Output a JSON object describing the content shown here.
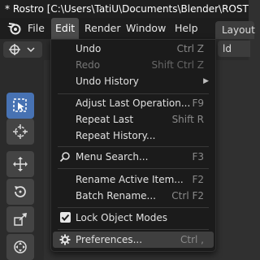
{
  "window": {
    "title": "* Rostro [C:\\Users\\TatiU\\Documents\\Blender\\ROSTRO"
  },
  "menubar": {
    "items": [
      "File",
      "Edit",
      "Render",
      "Window",
      "Help"
    ],
    "active": "Edit",
    "workspace_tab": "Layout"
  },
  "header": {
    "right_dropdown": "ld"
  },
  "toolbar": {
    "tools": [
      "select-box",
      "cursor",
      "move",
      "rotate",
      "scale",
      "transform"
    ],
    "active": "select-box"
  },
  "edit_menu": {
    "items": [
      {
        "label": "Undo",
        "shortcut": "Ctrl Z",
        "enabled": true
      },
      {
        "label": "Redo",
        "shortcut": "Shift Ctrl Z",
        "enabled": false
      },
      {
        "label": "Undo History",
        "shortcut": "",
        "enabled": true,
        "submenu": true
      },
      {
        "label": "Adjust Last Operation...",
        "shortcut": "F9",
        "enabled": true
      },
      {
        "label": "Repeat Last",
        "shortcut": "Shift R",
        "enabled": true
      },
      {
        "label": "Repeat History...",
        "shortcut": "",
        "enabled": true
      },
      {
        "label": "Menu Search...",
        "shortcut": "F3",
        "enabled": true,
        "icon": "search-icon"
      },
      {
        "label": "Rename Active Item...",
        "shortcut": "F2",
        "enabled": true
      },
      {
        "label": "Batch Rename...",
        "shortcut": "Ctrl F2",
        "enabled": true
      },
      {
        "label": "Lock Object Modes",
        "shortcut": "",
        "enabled": true,
        "checkbox": true,
        "checked": true
      },
      {
        "label": "Preferences...",
        "shortcut": "Ctrl ,",
        "enabled": true,
        "icon": "gear-icon",
        "highlighted": true
      }
    ]
  },
  "colors": {
    "accent": "#4772b3",
    "menu_bg": "#1b1b1b",
    "app_bg": "#303030"
  }
}
